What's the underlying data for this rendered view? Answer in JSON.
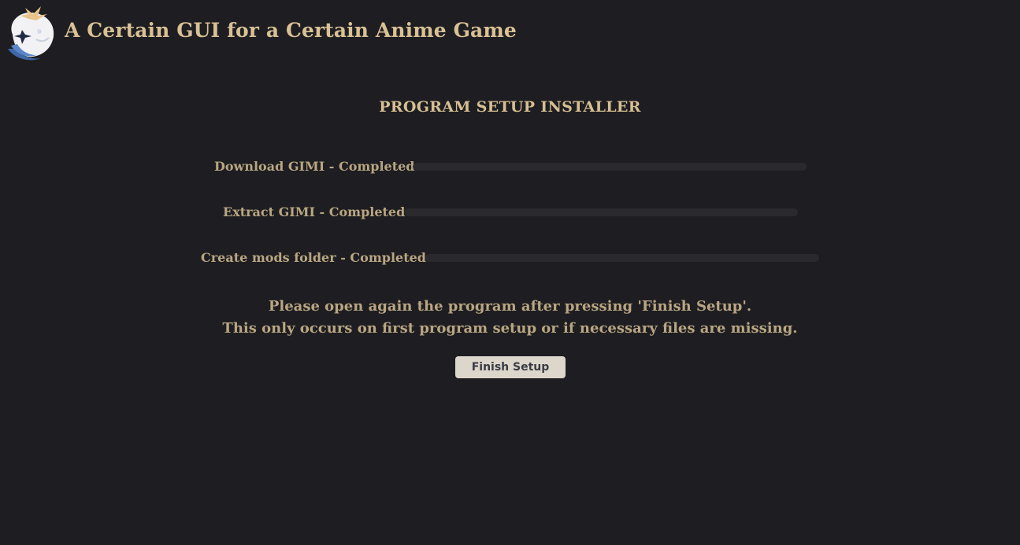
{
  "app": {
    "title": "A Certain GUI for a Certain Anime Game",
    "logo_icon": "paimon-mascot-icon"
  },
  "installer": {
    "title": "PROGRAM SETUP INSTALLER",
    "steps": [
      {
        "label": "Download GIMI - Completed",
        "progress": 0
      },
      {
        "label": "Extract GIMI - Completed",
        "progress": 0
      },
      {
        "label": "Create mods folder - Completed",
        "progress": 0
      }
    ],
    "message_line1": "Please open again the program after pressing 'Finish Setup'.",
    "message_line2": "This only occurs on first program setup or if necessary files are missing.",
    "finish_label": "Finish Setup"
  },
  "colors": {
    "background": "#1e1e22",
    "accent_text": "#d9c195",
    "muted_text": "#b9a682",
    "progress_track": "#2a2a2e",
    "button_bg": "#dcd6cb",
    "button_text": "#3b3b45"
  }
}
